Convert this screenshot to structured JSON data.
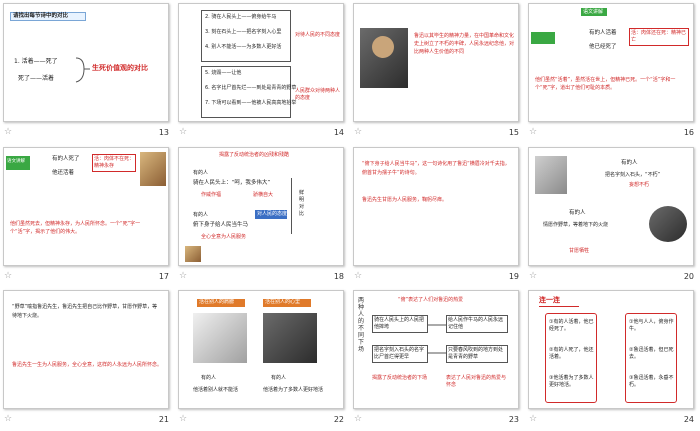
{
  "slides": [
    {
      "num": "13",
      "title": "请找出每节诗中的对比",
      "line1": "1. 活着——死了",
      "line2": "死了——活着",
      "result": "生死价值观的对比"
    },
    {
      "num": "14",
      "row1": "2. 骑在人民头上——俯身给牛马",
      "row2": "3. 刻在石头上——把名字刻入心里",
      "row3": "4. 别人不能活——为多数人更好活",
      "row4": "5. 烧毁——让他",
      "row5": "6. 名字比尸首先烂——到处是青青的野草",
      "row6": "7. 下场可以看到——他被人民高高地抬举",
      "note1": "对待人民的不同态度",
      "note2": "人民群众对待两种人的态度"
    },
    {
      "num": "15",
      "caption": "鲁迅以其毕生的精神力量，在中国革命和文化史上树立了不朽的丰碑，人民永远纪念他，对比两种人生价值的不同"
    },
    {
      "num": "16",
      "header": "语文讲解",
      "tag1": "有的人活着",
      "tag2": "他已经死了",
      "red": "活：肉体还在死：精神已亡",
      "para": "他们虽然“活着”，虽然活在世上，但精神已死。一个“活”字和一个“死”字，道出了他们可耻的本质。"
    },
    {
      "num": "17",
      "tag": "有的人死了",
      "tag2": "他还活着",
      "red": "活：肉体不在死：精神永存",
      "side": "语文讲解",
      "para": "他们虽然死去，但精神永存，为人民所怀念。一个“死”字一个“活”字，揭示了他们的伟大。"
    },
    {
      "num": "18",
      "top": "揭露了反动统治者的凶残和残酷",
      "l1": "有的人",
      "l2": "骑在人民头上：“呵，我多伟大”",
      "l3": "作威作福",
      "l4": "骄横自大",
      "r": "鲜明对比",
      "l5": "有的人",
      "l6": "俯下身子给人民当牛马",
      "l7": "全心全意为人民服务",
      "badge": "对人民的态度"
    },
    {
      "num": "19",
      "p1": "“俯下身子给人民当牛马”，这一句诗化用了鲁迅“横眉冷对千夫指，俯首甘为孺子牛”的诗句。",
      "p2": "鲁迅先生甘愿为人民服务，鞠躬尽瘁。"
    },
    {
      "num": "20",
      "a1": "有的人",
      "a2": "把名字刻入石头，“不朽”",
      "a3": "妄想不朽",
      "a4": "有的人",
      "a5": "情愿作野草，等着地下的火烧",
      "a6": "甘愿牺牲"
    },
    {
      "num": "21",
      "p1": "“野草”喻指鲁迅先生，鲁迅先生把自己比作野草，甘愿作野草，等待地下火烧。",
      "p2": "鲁迅先生一生为人民服务，全心全意，这样的人永远为人民所怀念。"
    },
    {
      "num": "22",
      "h1": "活在别人的肩膀",
      "h2": "活在别人的心里",
      "c1a": "有的人",
      "c1b": "他活着别人就不能活",
      "c2a": "有的人",
      "c2b": "他活着为了多数人更好地活"
    },
    {
      "num": "23",
      "vtitle": "两种人的不同下场",
      "top": "“俯”表达了人们对鲁迅的热爱",
      "b1": "骑在人民头上的人民把他摔垮",
      "b2": "给人民作牛马的人民永远记住他",
      "b3": "把名字刻入石头的名字比尸首烂得更早",
      "b4": "只要春风吹到的地方到处是青青的野草",
      "f1": "揭露了反动统治者的下场",
      "f2": "表达了人民对鲁迅的热爱与怀念"
    },
    {
      "num": "24",
      "title": "连一连",
      "l1": "①有的人活着，他已经死了。",
      "l2": "②有的人死了，他还活着。",
      "l3": "③他活着为了多数人更好地活。",
      "r1": "①他与人人，俯身作牛。",
      "r2": "②鲁迅活着，但已死去。",
      "r3": "③鲁迅活着，永垂不朽。"
    }
  ]
}
